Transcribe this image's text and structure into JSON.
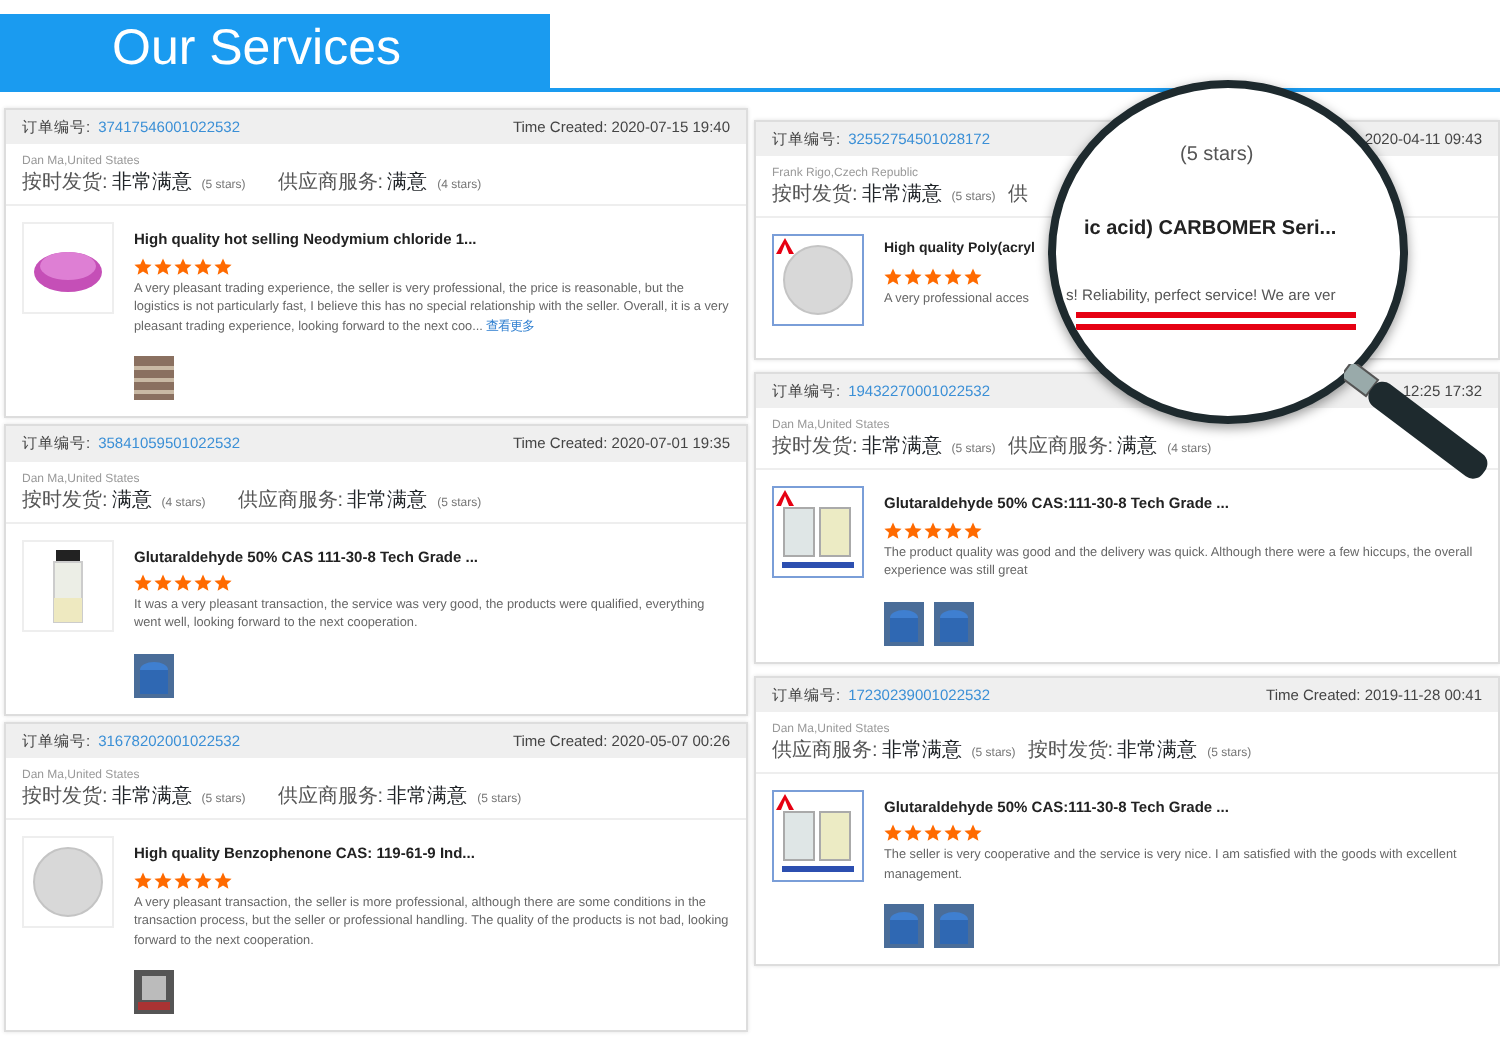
{
  "header": {
    "title": "Our Services"
  },
  "columns": [
    {
      "cards": [
        {
          "order_label": "订单编号:",
          "order_no": "37417546001022532",
          "time": "Time Created: 2020-07-15 19:40",
          "buyer": "Dan Ma,United States",
          "ratings": [
            {
              "label": "按时发货:",
              "value": "非常满意",
              "note": "(5 stars)"
            },
            {
              "label": "供应商服务:",
              "value": "满意",
              "note": "(4 stars)"
            }
          ],
          "product": {
            "kind": "pink-powder",
            "badge": false,
            "title": "High quality hot selling Neodymium chloride 1...",
            "stars": 5,
            "comment": "A very pleasant trading experience, the seller is very professional, the price is reasonable, but the logistics is not particularly fast, I believe this has no special relationship with the seller. Overall, it is a very pleasant trading experience, looking forward to the next coo...",
            "more": "查看更多"
          },
          "photos": [
            {
              "kind": "sacks"
            }
          ]
        },
        {
          "order_label": "订单编号:",
          "order_no": "35841059501022532",
          "time": "Time Created: 2020-07-01 19:35",
          "buyer": "Dan Ma,United States",
          "ratings": [
            {
              "label": "按时发货:",
              "value": "满意",
              "note": "(4 stars)"
            },
            {
              "label": "供应商服务:",
              "value": "非常满意",
              "note": "(5 stars)"
            }
          ],
          "product": {
            "kind": "bottle",
            "badge": false,
            "title": "Glutaraldehyde 50% CAS 111-30-8 Tech Grade ...",
            "stars": 5,
            "comment": "It was a very pleasant transaction, the service was very good, the products were qualified, everything went well, looking forward to the next cooperation."
          },
          "photos": [
            {
              "kind": "drums"
            }
          ]
        },
        {
          "order_label": "订单编号:",
          "order_no": "31678202001022532",
          "time": "Time Created: 2020-05-07 00:26",
          "buyer": "Dan Ma,United States",
          "ratings": [
            {
              "label": "按时发货:",
              "value": "非常满意",
              "note": "(5 stars)"
            },
            {
              "label": "供应商服务:",
              "value": "非常满意",
              "note": "(5 stars)"
            }
          ],
          "product": {
            "kind": "white-powder",
            "badge": false,
            "title": "High quality Benzophenone CAS: 119-61-9 Ind...",
            "stars": 5,
            "comment": "A very pleasant transaction, the seller is more professional, although there are some conditions in the transaction process, but the seller or professional handling. The quality of the products is not bad, looking forward to the next cooperation."
          },
          "photos": [
            {
              "kind": "bag"
            }
          ]
        }
      ]
    },
    {
      "cards": [
        {
          "order_label": "订单编号:",
          "order_no": "32552754501028172",
          "time": "2020-04-11 09:43",
          "buyer": "Frank Rigo,Czech Republic",
          "ratings": [
            {
              "label": "按时发货:",
              "value": "非常满意",
              "note": "(5 stars)"
            },
            {
              "label": "供"
            }
          ],
          "product": {
            "kind": "white-powder",
            "badge": true,
            "title": "High quality Poly(acryl",
            "stars": 5,
            "comment": "A very professional acces"
          }
        },
        {
          "order_label": "订单编号:",
          "order_no": "19432270001022532",
          "time": "12:25 17:32",
          "buyer": "Dan Ma,United States",
          "ratings": [
            {
              "label": "按时发货:",
              "value": "非常满意",
              "note": "(5 stars)"
            },
            {
              "label": "供应商服务:",
              "value": "满意",
              "note": "(4 stars)"
            }
          ],
          "product": {
            "kind": "jars",
            "badge": true,
            "title": "Glutaraldehyde 50% CAS:111-30-8 Tech Grade ...",
            "stars": 5,
            "comment": "The product quality was good and the delivery was quick. Although there were a few hiccups, the overall experience was still great"
          },
          "photos": [
            {
              "kind": "drums"
            },
            {
              "kind": "drums"
            }
          ]
        },
        {
          "order_label": "订单编号:",
          "order_no": "17230239001022532",
          "time": "Time Created: 2019-11-28 00:41",
          "buyer": "Dan Ma,United States",
          "ratings": [
            {
              "label": "供应商服务:",
              "value": "非常满意",
              "note": "(5 stars)"
            },
            {
              "label": "按时发货:",
              "value": "非常满意",
              "note": "(5 stars)"
            }
          ],
          "product": {
            "kind": "jars",
            "badge": true,
            "title": "Glutaraldehyde 50% CAS:111-30-8 Tech Grade ...",
            "stars": 5,
            "comment": "The seller is very cooperative and the service is very nice. I am satisfied with the goods with excellent management."
          },
          "photos": [
            {
              "kind": "drums"
            },
            {
              "kind": "drums"
            }
          ]
        }
      ]
    }
  ],
  "magnifier": {
    "underline": true,
    "lines": [
      {
        "kind": "rating",
        "text": "(5 stars)"
      },
      {
        "kind": "title",
        "text": "ic acid) CARBOMER Seri..."
      },
      {
        "kind": "comment",
        "text": "s! Reliability, perfect service! We are ver"
      }
    ]
  }
}
